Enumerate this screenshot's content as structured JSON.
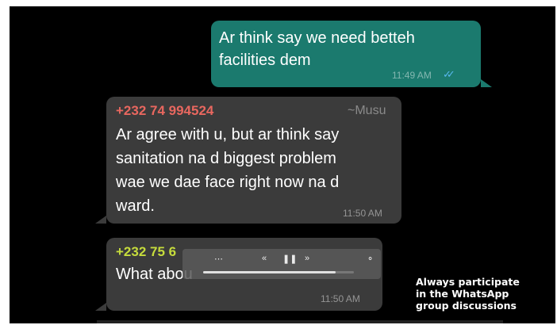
{
  "messages": [
    {
      "direction": "outgoing",
      "text_lines": [
        "Ar think say we need betteh",
        "facilities dem"
      ],
      "time": "11:49 AM",
      "status_icon": "double-check-read-icon",
      "status_glyph": "✓✓"
    },
    {
      "direction": "incoming",
      "sender_phone": "+232 74 994524",
      "sender_name": "~Musu",
      "sender_color": "#e8675f",
      "text_lines": [
        "Ar agree with u, but ar think say",
        "sanitation na d biggest problem",
        "wae we dae face right now na d",
        "ward."
      ],
      "time": "11:50 AM"
    },
    {
      "direction": "incoming",
      "sender_phone": "+232 75 6",
      "sender_color": "#c6dc3c",
      "text_lines": [
        "What abou"
      ],
      "time": "11:50 AM"
    }
  ],
  "media_player": {
    "controls": [
      "⋯",
      "«",
      "❚❚",
      "»",
      "⚬"
    ],
    "progress": 0.88
  },
  "caption": [
    "Always participate",
    "in the WhatsApp",
    "group discussions"
  ],
  "colors": {
    "background": "#000000",
    "outgoing_bubble": "#1b7a6e",
    "incoming_bubble": "#3b3b3b",
    "read_receipt": "#58b8ee"
  }
}
